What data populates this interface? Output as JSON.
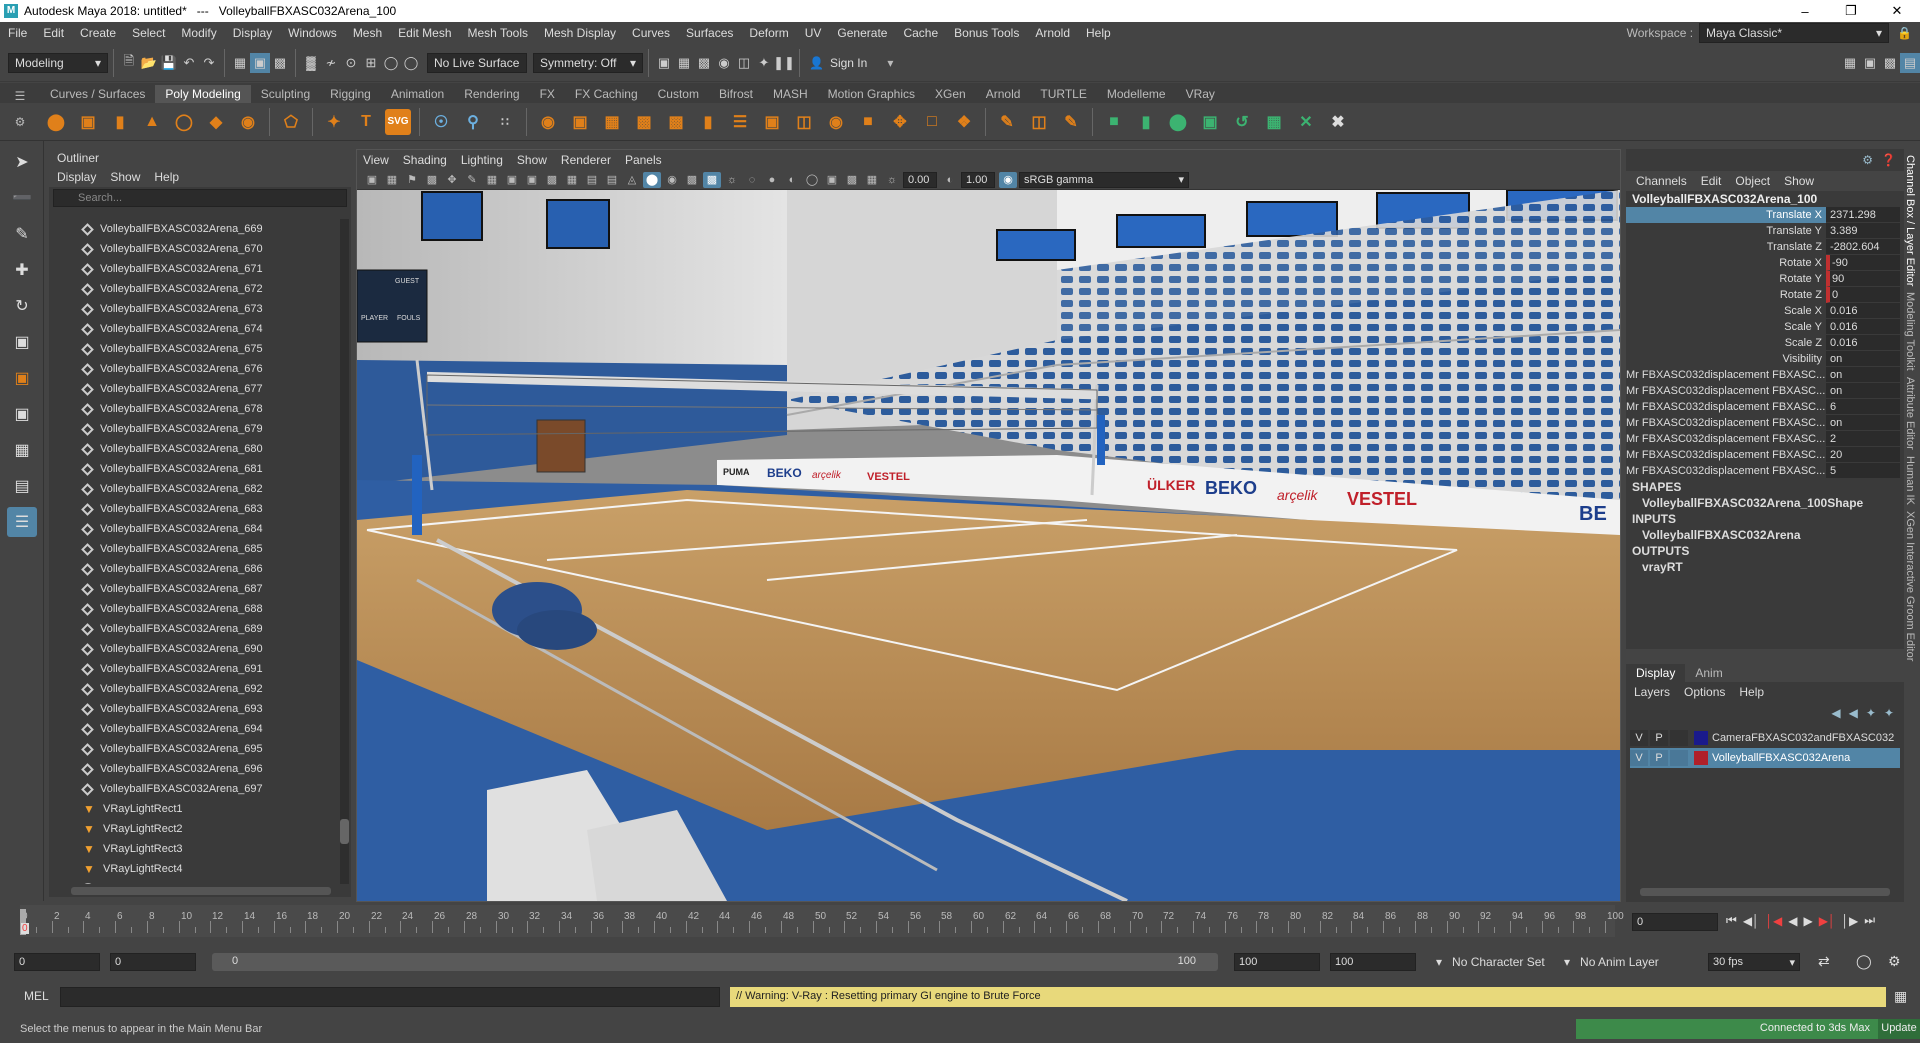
{
  "titlebar": {
    "title": "Autodesk Maya 2018: untitled*   ---   VolleyballFBXASC032Arena_100"
  },
  "menus": [
    "File",
    "Edit",
    "Create",
    "Select",
    "Modify",
    "Display",
    "Windows",
    "Mesh",
    "Edit Mesh",
    "Mesh Tools",
    "Mesh Display",
    "Curves",
    "Surfaces",
    "Deform",
    "UV",
    "Generate",
    "Cache",
    "Bonus Tools",
    "Arnold",
    "Help"
  ],
  "workspace": {
    "label": "Workspace :",
    "value": "Maya Classic*"
  },
  "statusline": {
    "mode": "Modeling",
    "live_surface": "No Live Surface",
    "symmetry": "Symmetry: Off",
    "sign_in": "Sign In"
  },
  "shelf_tabs": [
    "Curves / Surfaces",
    "Poly Modeling",
    "Sculpting",
    "Rigging",
    "Animation",
    "Rendering",
    "FX",
    "FX Caching",
    "Custom",
    "Bifrost",
    "MASH",
    "Motion Graphics",
    "XGen",
    "Arnold",
    "TURTLE",
    "Modelleme",
    "VRay"
  ],
  "shelf_active": "Poly Modeling",
  "outliner": {
    "title": "Outliner",
    "menu": [
      "Display",
      "Show",
      "Help"
    ],
    "search_placeholder": "Search...",
    "items": [
      "VolleyballFBXASC032Arena_669",
      "VolleyballFBXASC032Arena_670",
      "VolleyballFBXASC032Arena_671",
      "VolleyballFBXASC032Arena_672",
      "VolleyballFBXASC032Arena_673",
      "VolleyballFBXASC032Arena_674",
      "VolleyballFBXASC032Arena_675",
      "VolleyballFBXASC032Arena_676",
      "VolleyballFBXASC032Arena_677",
      "VolleyballFBXASC032Arena_678",
      "VolleyballFBXASC032Arena_679",
      "VolleyballFBXASC032Arena_680",
      "VolleyballFBXASC032Arena_681",
      "VolleyballFBXASC032Arena_682",
      "VolleyballFBXASC032Arena_683",
      "VolleyballFBXASC032Arena_684",
      "VolleyballFBXASC032Arena_685",
      "VolleyballFBXASC032Arena_686",
      "VolleyballFBXASC032Arena_687",
      "VolleyballFBXASC032Arena_688",
      "VolleyballFBXASC032Arena_689",
      "VolleyballFBXASC032Arena_690",
      "VolleyballFBXASC032Arena_691",
      "VolleyballFBXASC032Arena_692",
      "VolleyballFBXASC032Arena_693",
      "VolleyballFBXASC032Arena_694",
      "VolleyballFBXASC032Arena_695",
      "VolleyballFBXASC032Arena_696",
      "VolleyballFBXASC032Arena_697"
    ],
    "lights": [
      "VRayLightRect1",
      "VRayLightRect2",
      "VRayLightRect3",
      "VRayLightRect4"
    ],
    "last_item": "defaultLightSet"
  },
  "viewport": {
    "menu": [
      "View",
      "Shading",
      "Lighting",
      "Show",
      "Renderer",
      "Panels"
    ],
    "field1": "0.00",
    "field2": "1.00",
    "color_space": "sRGB gamma",
    "signs": {
      "beko": "BEKO",
      "arcelik": "arçelik",
      "vestel": "VESTEL",
      "ulker": "ÜLKER",
      "puma": "PUMA",
      "guest": "GUEST",
      "player": "PLAYER",
      "fouls": "FOULS"
    }
  },
  "channelbox": {
    "menu": [
      "Channels",
      "Edit",
      "Object",
      "Show"
    ],
    "object": "VolleyballFBXASC032Arena_100",
    "channels": [
      {
        "label": "Translate X",
        "value": "2371.298",
        "selected": true
      },
      {
        "label": "Translate Y",
        "value": "3.389"
      },
      {
        "label": "Translate Z",
        "value": "-2802.604"
      },
      {
        "label": "Rotate X",
        "value": "-90",
        "keyed": true
      },
      {
        "label": "Rotate Y",
        "value": "90",
        "keyed": true
      },
      {
        "label": "Rotate Z",
        "value": "0",
        "keyed": true
      },
      {
        "label": "Scale X",
        "value": "0.016"
      },
      {
        "label": "Scale Y",
        "value": "0.016"
      },
      {
        "label": "Scale Z",
        "value": "0.016"
      },
      {
        "label": "Visibility",
        "value": "on"
      },
      {
        "label": "Mr FBXASC032displacement FBXASC...",
        "value": "on"
      },
      {
        "label": "Mr FBXASC032displacement FBXASC...",
        "value": "on"
      },
      {
        "label": "Mr FBXASC032displacement FBXASC...",
        "value": "6"
      },
      {
        "label": "Mr FBXASC032displacement FBXASC...",
        "value": "on"
      },
      {
        "label": "Mr FBXASC032displacement FBXASC...",
        "value": "2"
      },
      {
        "label": "Mr FBXASC032displacement FBXASC...",
        "value": "20"
      },
      {
        "label": "Mr FBXASC032displacement FBXASC...",
        "value": "5"
      }
    ],
    "shapes_header": "SHAPES",
    "shape": "VolleyballFBXASC032Arena_100Shape",
    "inputs_header": "INPUTS",
    "input": "VolleyballFBXASC032Arena",
    "outputs_header": "OUTPUTS",
    "output": "vrayRT"
  },
  "sidetabs": [
    "Channel Box / Layer Editor",
    "Modeling Toolkit",
    "Attribute Editor",
    "Human IK",
    "XGen Interactive Groom Editor"
  ],
  "layers": {
    "tabs": [
      "Display",
      "Anim"
    ],
    "menu": [
      "Layers",
      "Options",
      "Help"
    ],
    "rows": [
      {
        "v": "V",
        "p": "P",
        "name": "CameraFBXASC032andFBXASC032",
        "color": "#1a1a8c"
      },
      {
        "v": "V",
        "p": "P",
        "name": "VolleyballFBXASC032Arena",
        "color": "#b0202a",
        "selected": true
      }
    ]
  },
  "timeslider": {
    "ticks": [
      "0",
      "2",
      "4",
      "6",
      "8",
      "10",
      "12",
      "14",
      "16",
      "18",
      "20",
      "22",
      "24",
      "26",
      "28",
      "30",
      "32",
      "34",
      "36",
      "38",
      "40",
      "42",
      "44",
      "46",
      "48",
      "50",
      "52",
      "54",
      "56",
      "58",
      "60",
      "62",
      "64",
      "66",
      "68",
      "70",
      "72",
      "74",
      "76",
      "78",
      "80",
      "82",
      "84",
      "86",
      "88",
      "90",
      "92",
      "94",
      "96",
      "98",
      "100"
    ],
    "current": "0",
    "current_field": "0"
  },
  "range": {
    "start": "0",
    "inner_start": "0",
    "slider_start": "0",
    "slider_end": "100",
    "inner_end": "100",
    "end": "100",
    "character": "No Character Set",
    "anim_layer": "No Anim Layer",
    "fps": "30 fps"
  },
  "cmdline": {
    "lang": "MEL",
    "warning": "// Warning: V-Ray : Resetting primary GI engine to Brute Force"
  },
  "helpline": {
    "text": "Select the menus to appear in the Main Menu Bar",
    "connected": "Connected to 3ds Max",
    "update": "Update"
  }
}
